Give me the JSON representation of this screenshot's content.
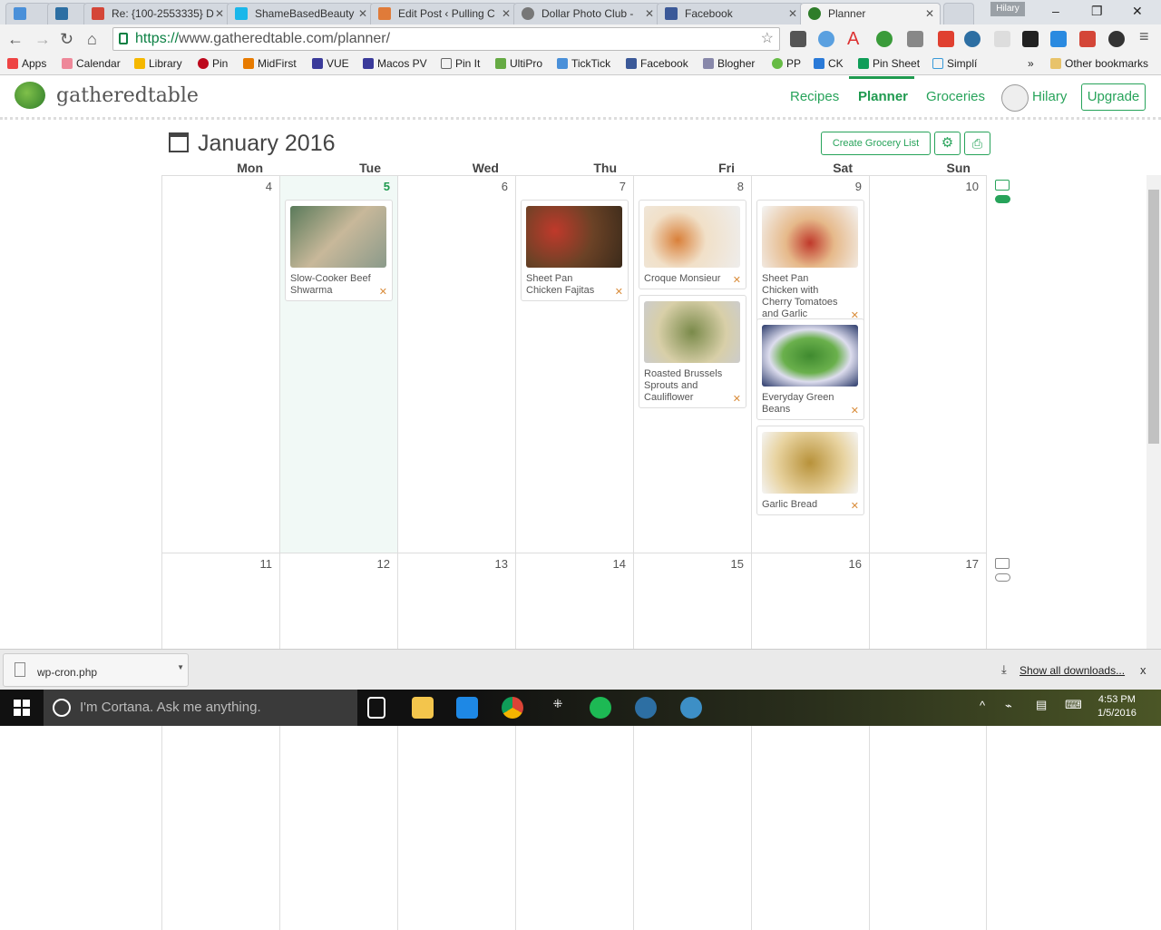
{
  "browser": {
    "tabs": [
      {
        "label": "",
        "color": "#4a90d9"
      },
      {
        "label": "",
        "color": "#2d6fa3"
      },
      {
        "label": "Re: {100-2553335} D",
        "color": "#d44638"
      },
      {
        "label": "ShameBasedBeauty",
        "color": "#1ab7ea"
      },
      {
        "label": "Edit Post ‹ Pulling C",
        "color": "#e07b39"
      },
      {
        "label": "Dollar Photo Club -",
        "color": "#777"
      },
      {
        "label": "Facebook",
        "color": "#3b5998"
      },
      {
        "label": "Planner",
        "color": "#2f7d2a"
      }
    ],
    "profile": "Hilary",
    "url_scheme": "https://",
    "url_rest": "www.gatheredtable.com/planner/",
    "bookmarks": [
      "Apps",
      "Calendar",
      "Library",
      "Pin",
      "MidFirst",
      "VUE",
      "Macos PV",
      "Pin It",
      "UltiPro",
      "TickTick",
      "Facebook",
      "Blogher",
      "PP",
      "CK",
      "Pin Sheet",
      "Simplí"
    ],
    "bookmark_overflow": "»",
    "other_bookmarks": "Other bookmarks"
  },
  "site": {
    "logo": "gatheredtable",
    "nav": [
      "Recipes",
      "Planner",
      "Groceries"
    ],
    "user": "Hilary",
    "upgrade": "Upgrade",
    "accent": "#27a35a"
  },
  "planner": {
    "month": "January 2016",
    "create_grocery": "Create Grocery List",
    "days_of_week": [
      "Mon",
      "Tue",
      "Wed",
      "Thu",
      "Fri",
      "Sat",
      "Sun"
    ],
    "weeks": [
      {
        "days": [
          {
            "num": "4",
            "meals": []
          },
          {
            "num": "5",
            "today": true,
            "meals": [
              {
                "title": "Slow-Cooker Beef Shwarma"
              }
            ]
          },
          {
            "num": "6",
            "meals": []
          },
          {
            "num": "7",
            "meals": [
              {
                "title": "Sheet Pan Chicken Fajitas"
              }
            ]
          },
          {
            "num": "8",
            "meals": [
              {
                "title": "Croque Monsieur"
              },
              {
                "title": "Roasted Brussels Sprouts and Cauliflower"
              }
            ]
          },
          {
            "num": "9",
            "meals": [
              {
                "title": "Sheet Pan Chicken with Cherry Tomatoes and Garlic"
              },
              {
                "title": "Everyday Green Beans"
              },
              {
                "title": "Garlic Bread"
              }
            ]
          },
          {
            "num": "10",
            "meals": []
          }
        ]
      },
      {
        "days": [
          {
            "num": "11",
            "meals": []
          },
          {
            "num": "12",
            "meals": []
          },
          {
            "num": "13",
            "meals": []
          },
          {
            "num": "14",
            "meals": []
          },
          {
            "num": "15",
            "meals": []
          },
          {
            "num": "16",
            "meals": []
          },
          {
            "num": "17",
            "meals": []
          }
        ]
      }
    ]
  },
  "downloads": {
    "file": "wp-cron.php",
    "show_all": "Show all downloads...",
    "close": "x"
  },
  "taskbar": {
    "cortana": "I'm Cortana. Ask me anything.",
    "time": "4:53 PM",
    "date": "1/5/2016"
  }
}
